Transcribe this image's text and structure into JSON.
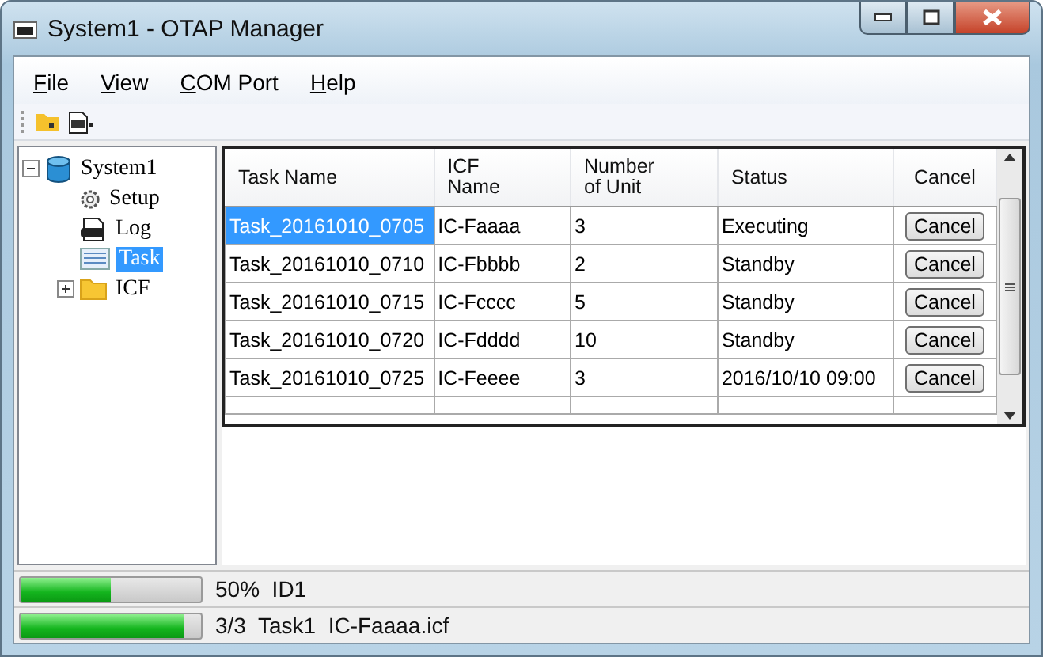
{
  "window": {
    "title": "System1 - OTAP Manager"
  },
  "menu": [
    {
      "label": "File"
    },
    {
      "label": "View"
    },
    {
      "label": "COM Port"
    },
    {
      "label": "Help"
    }
  ],
  "tree": [
    {
      "label": "System1",
      "kind": "database",
      "expanded": true,
      "selected": false,
      "children": [
        {
          "label": "Setup",
          "kind": "gear",
          "selected": false
        },
        {
          "label": "Log",
          "kind": "log",
          "selected": false
        },
        {
          "label": "Task",
          "kind": "task",
          "selected": true
        },
        {
          "label": "ICF",
          "kind": "folder",
          "expanded": false,
          "selected": false
        }
      ]
    }
  ],
  "table": {
    "columns": [
      "Task Name",
      "ICF Name",
      "Number of Unit",
      "Status",
      "Cancel"
    ],
    "rows": [
      {
        "task_name": "Task_20161010_0705",
        "icf_name": "IC-Faaaa",
        "units": "3",
        "status": "Executing",
        "button": "Cancel",
        "selected": true
      },
      {
        "task_name": "Task_20161010_0710",
        "icf_name": "IC-Fbbbb",
        "units": "2",
        "status": "Standby",
        "button": "Cancel",
        "selected": false
      },
      {
        "task_name": "Task_20161010_0715",
        "icf_name": "IC-Fcccc",
        "units": "5",
        "status": "Standby",
        "button": "Cancel",
        "selected": false
      },
      {
        "task_name": "Task_20161010_0720",
        "icf_name": "IC-Fdddd",
        "units": "10",
        "status": "Standby",
        "button": "Cancel",
        "selected": false
      },
      {
        "task_name": "Task_20161010_0725",
        "icf_name": "IC-Feeee",
        "units": "3",
        "status": "2016/10/10 09:00",
        "button": "Cancel",
        "selected": false
      }
    ]
  },
  "status_bars": [
    {
      "level": 0.5,
      "text": "50%  ID1"
    },
    {
      "level": 0.9,
      "text": "3/3  Task1  IC-Faaaa.icf"
    }
  ]
}
